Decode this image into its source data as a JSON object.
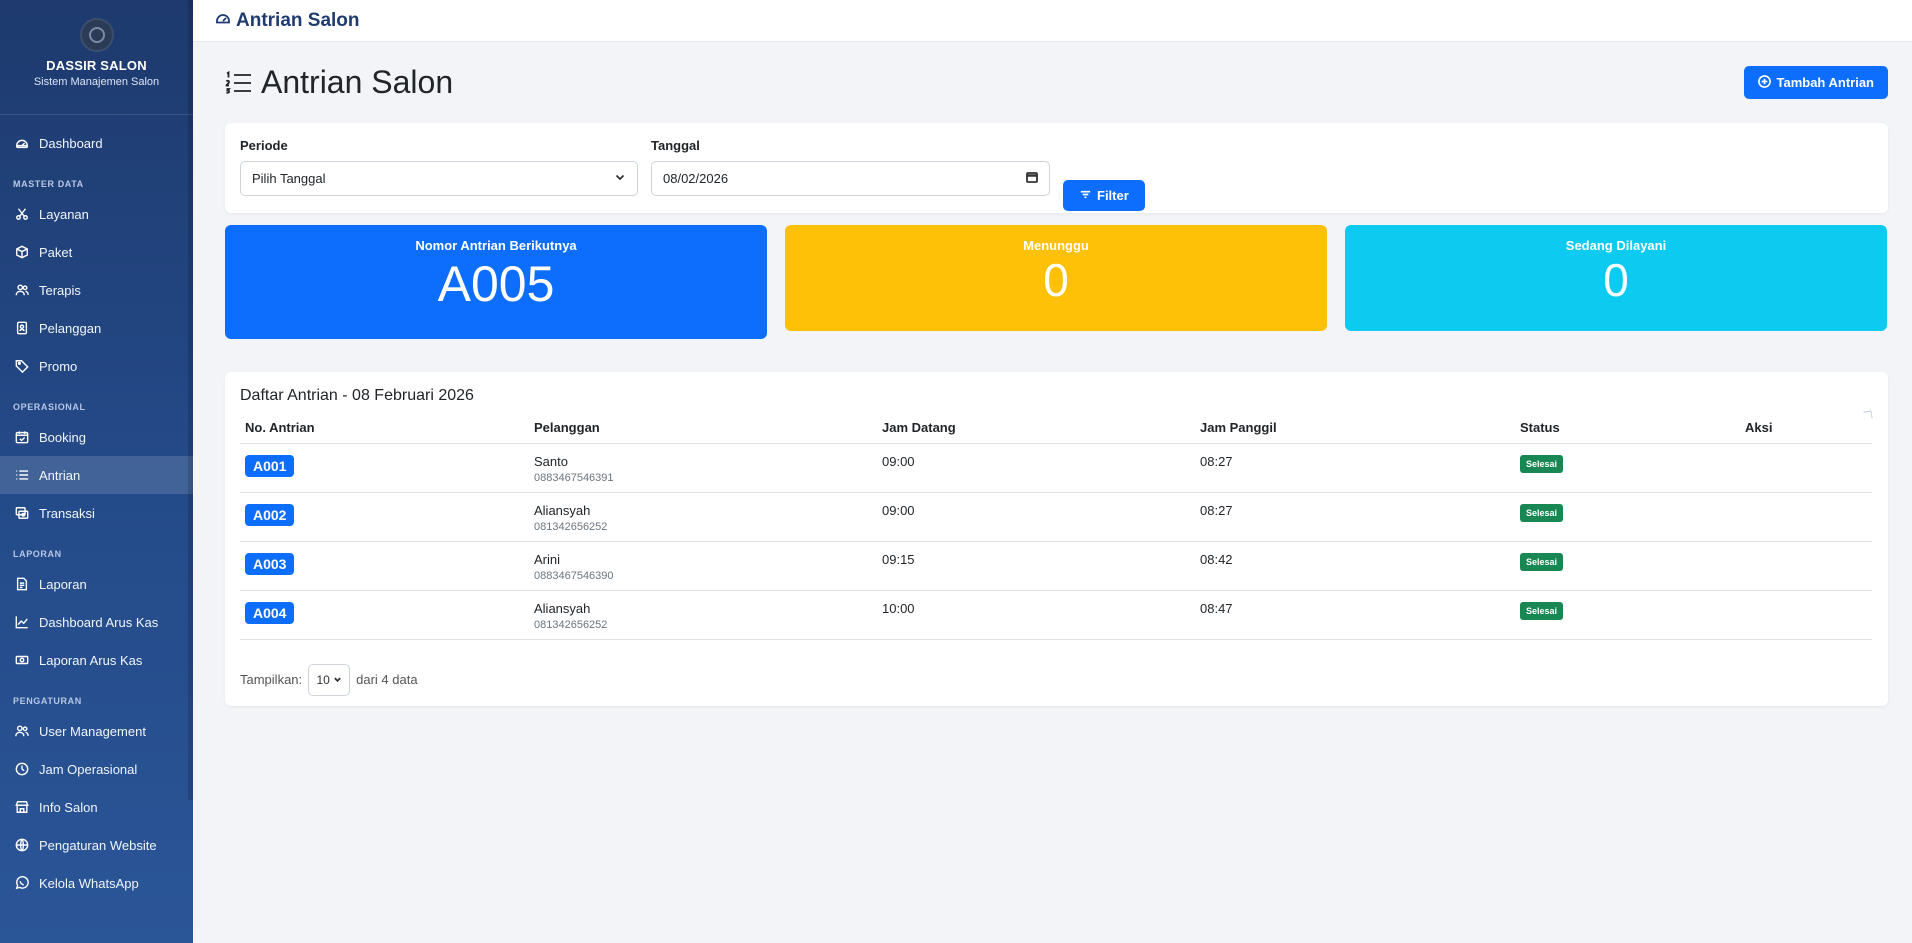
{
  "sidebar": {
    "brand_name": "DASSIR SALON",
    "brand_sub": "Sistem Manajemen Salon",
    "dashboard": "Dashboard",
    "sections": {
      "master": "MASTER DATA",
      "operasional": "OPERASIONAL",
      "laporan": "LAPORAN",
      "pengaturan": "PENGATURAN"
    },
    "master_items": [
      "Layanan",
      "Paket",
      "Terapis",
      "Pelanggan",
      "Promo"
    ],
    "operasional_items": [
      "Booking",
      "Antrian",
      "Transaksi"
    ],
    "laporan_items": [
      "Laporan",
      "Dashboard Arus Kas",
      "Laporan Arus Kas"
    ],
    "pengaturan_items": [
      "User Management",
      "Jam Operasional",
      "Info Salon",
      "Pengaturan Website",
      "Kelola WhatsApp"
    ],
    "active_item": "Antrian"
  },
  "topbar": {
    "title": "Antrian Salon"
  },
  "page": {
    "title": "Antrian Salon",
    "add_button": "Tambah Antrian"
  },
  "filter": {
    "periode_label": "Periode",
    "periode_value": "Pilih Tanggal",
    "tanggal_label": "Tanggal",
    "tanggal_value": "08/02/2026",
    "filter_button": "Filter"
  },
  "stats": {
    "next": {
      "label": "Nomor Antrian Berikutnya",
      "value": "A005"
    },
    "waiting": {
      "label": "Menunggu",
      "value": "0"
    },
    "serving": {
      "label": "Sedang Dilayani",
      "value": "0"
    }
  },
  "table": {
    "title": "Daftar Antrian - 08 Februari 2026",
    "columns": [
      "No. Antrian",
      "Pelanggan",
      "Jam Datang",
      "Jam Panggil",
      "Status",
      "Aksi"
    ],
    "rows": [
      {
        "no": "A001",
        "name": "Santo",
        "phone": "0883467546391",
        "datang": "09:00",
        "panggil": "08:27",
        "status": "Selesai"
      },
      {
        "no": "A002",
        "name": "Aliansyah",
        "phone": "081342656252",
        "datang": "09:00",
        "panggil": "08:27",
        "status": "Selesai"
      },
      {
        "no": "A003",
        "name": "Arini",
        "phone": "0883467546390",
        "datang": "09:15",
        "panggil": "08:42",
        "status": "Selesai"
      },
      {
        "no": "A004",
        "name": "Aliansyah",
        "phone": "081342656252",
        "datang": "10:00",
        "panggil": "08:47",
        "status": "Selesai"
      }
    ],
    "footer": {
      "show_label": "Tampilkan:",
      "page_size": "10",
      "count_text": "dari 4 data"
    }
  },
  "colors": {
    "primary": "#0d6efd",
    "warning": "#ffc107",
    "info": "#0dcaf0",
    "success": "#198754",
    "sidebar": "#244a88"
  }
}
